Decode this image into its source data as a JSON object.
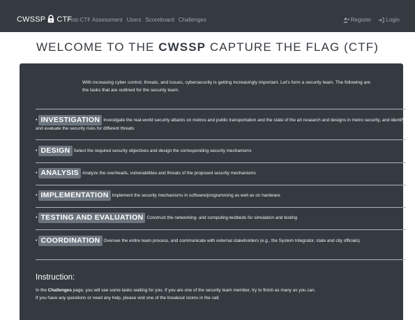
{
  "navbar": {
    "brand_left": "CWSSP",
    "brand_right": "CTF",
    "links": [
      "Post-CTF Assessment",
      "Users",
      "Scoreboard",
      "Challenges"
    ],
    "register_label": "Register",
    "login_label": "Login"
  },
  "title": {
    "prefix": "WELCOME TO THE",
    "strong": "CWSSP",
    "suffix": "CAPTURE THE FLAG (CTF)"
  },
  "intro": "With increasing cyber control, threats, and issues, cybersecurity is getting increasingly important. Let's form a security team. The following are the tasks that are outlined for the security team.",
  "tasks": [
    {
      "name": "INVESTIGATION",
      "desc": "Investigate the real-world security attacks on metros and public transportation and the state of the art research and designs in metro security, and identify and evaluate the security risks for different threats"
    },
    {
      "name": "DESIGN",
      "desc": "Select the required security objectives and design the corresponding security mechanisms"
    },
    {
      "name": "ANALYSIS",
      "desc": "Analyze the overheads, vulnerabilities and threats of the proposed security mechanisms"
    },
    {
      "name": "IMPLEMENTATION",
      "desc": "Implement the security mechanisms in software/programming as well as on hardware"
    },
    {
      "name": "TESTING AND EVALUATION",
      "desc": "Construct the networking- and computing-testbeds for simulation and testing"
    },
    {
      "name": "COORDINATION",
      "desc": "Oversee the entire team process, and communicate with external stakeholders (e.g., the System Integrator, state and city officials)"
    }
  ],
  "instruction": {
    "title": "Instruction:",
    "line1_pre": "In the",
    "line1_bold": "Challenges",
    "line1_post": "page, you will see some tasks waiting for you. If you are one of the security team member, try to finish as many as you can.",
    "line2": "If you have any questions or need any help, please visit one of the breakout rooms in the call."
  },
  "colors": {
    "navbar": "#343a40",
    "panel": "#343a40",
    "badge": "#6c757d",
    "nav_link": "#9da3a8"
  },
  "icons": {
    "brand": "lock-icon",
    "register": "user-plus-icon",
    "login": "sign-in-icon"
  }
}
